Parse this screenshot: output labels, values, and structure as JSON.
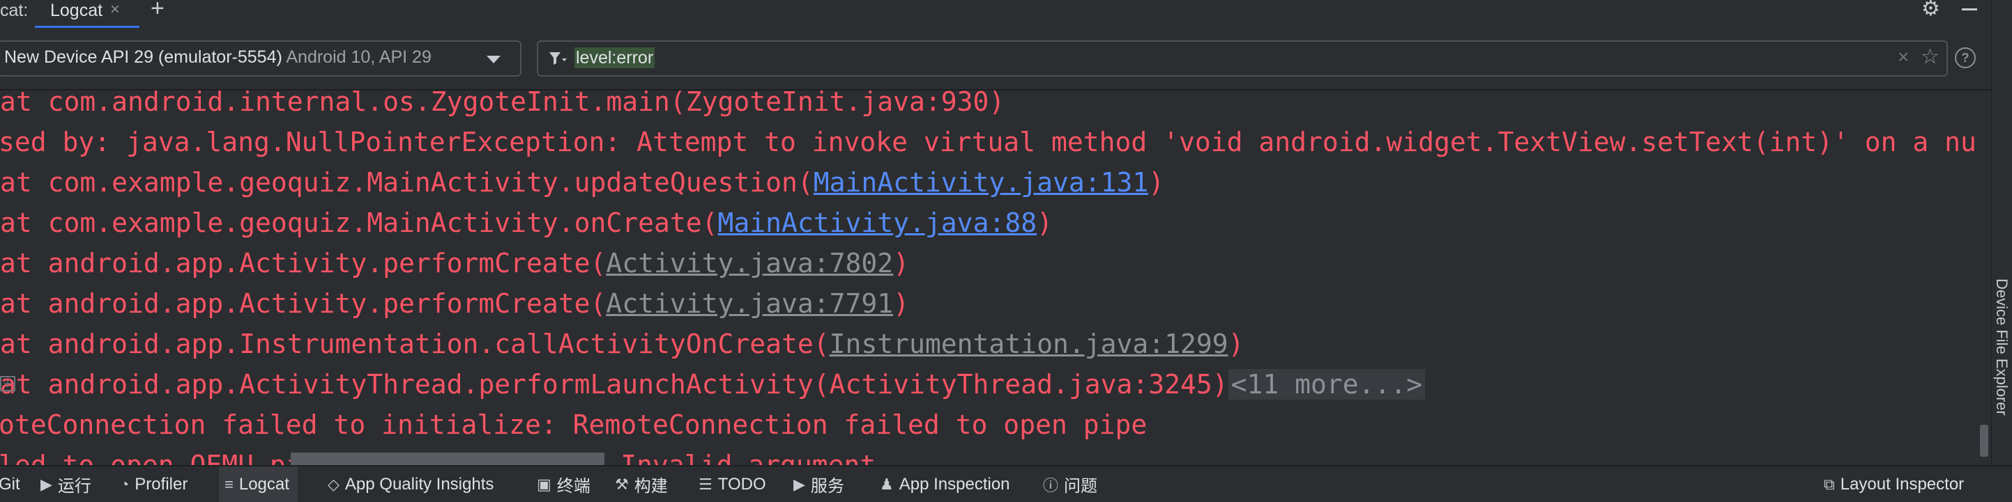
{
  "tabs": {
    "prefix": "cat:",
    "active_label": "Logcat",
    "close_glyph": "×",
    "add_glyph": "+"
  },
  "toolbar": {
    "device_name": "New Device API 29 (emulator-5554)",
    "device_api": "Android 10, API 29",
    "filter_value": "level:error",
    "clear_glyph": "×",
    "star_glyph": "☆",
    "help_glyph": "?"
  },
  "log": {
    "lines": [
      {
        "indent": "  ",
        "text": "at com.android.internal.os.ZygoteInit.main(ZygoteInit.java:930)"
      },
      {
        "indent": "",
        "text": "sed by: java.lang.NullPointerException: Attempt to invoke virtual method 'void android.widget.TextView.setText(int)' on a nu"
      },
      {
        "indent": "  ",
        "prefix": "at com.example.geoquiz.MainActivity.updateQuestion(",
        "link": "MainActivity.java:131",
        "suffix": ")"
      },
      {
        "indent": "  ",
        "prefix": "at com.example.geoquiz.MainActivity.onCreate(",
        "link": "MainActivity.java:88",
        "suffix": ")"
      },
      {
        "indent": "  ",
        "prefix": "at android.app.Activity.performCreate(",
        "link": "Activity.java:7802",
        "suffix": ")"
      },
      {
        "indent": "  ",
        "prefix": "at android.app.Activity.performCreate(",
        "link": "Activity.java:7791",
        "suffix": ")"
      },
      {
        "indent": "  ",
        "prefix": "at android.app.Instrumentation.callActivityOnCreate(",
        "link": "Instrumentation.java:1299",
        "suffix": ")"
      },
      {
        "indent": "  ",
        "text": "at android.app.ActivityThread.performLaunchActivity(ActivityThread.java:3245)",
        "more": "<11 more...>"
      },
      {
        "indent": "",
        "text": "oteConnection failed to initialize: RemoteConnection failed to open pipe"
      },
      {
        "indent": "",
        "text": "led to open QEMU pipe 'qemud:network': Invalid argument"
      }
    ],
    "expand_glyph": "+"
  },
  "side_panel": {
    "label": "Device File Explorer"
  },
  "bottom_bar": {
    "items": [
      {
        "label": "Git",
        "icon": ""
      },
      {
        "label": "运行",
        "icon": "▶"
      },
      {
        "label": "Profiler",
        "icon": "◔"
      },
      {
        "label": "Logcat",
        "icon": "≡"
      },
      {
        "label": "App Quality Insights",
        "icon": "◇"
      },
      {
        "label": "终端",
        "icon": "▣"
      },
      {
        "label": "构建",
        "icon": "⚒"
      },
      {
        "label": "TODO",
        "icon": "☰"
      },
      {
        "label": "服务",
        "icon": "▶"
      },
      {
        "label": "App Inspection",
        "icon": "♟"
      },
      {
        "label": "问题",
        "icon": "ⓘ"
      }
    ],
    "right_item": {
      "label": "Layout Inspector",
      "icon": "⧉"
    }
  },
  "colors": {
    "background": "#2b2d30",
    "error_text": "#f75464",
    "link_blue": "#548af7",
    "link_gray": "#8c8f94",
    "filter_highlight": "#39553a",
    "accent": "#3574f0"
  },
  "icons": [
    "gear-icon",
    "minimize-icon",
    "filter-icon",
    "clear-icon",
    "star-icon",
    "help-icon",
    "chevron-down-icon",
    "expand-icon"
  ]
}
